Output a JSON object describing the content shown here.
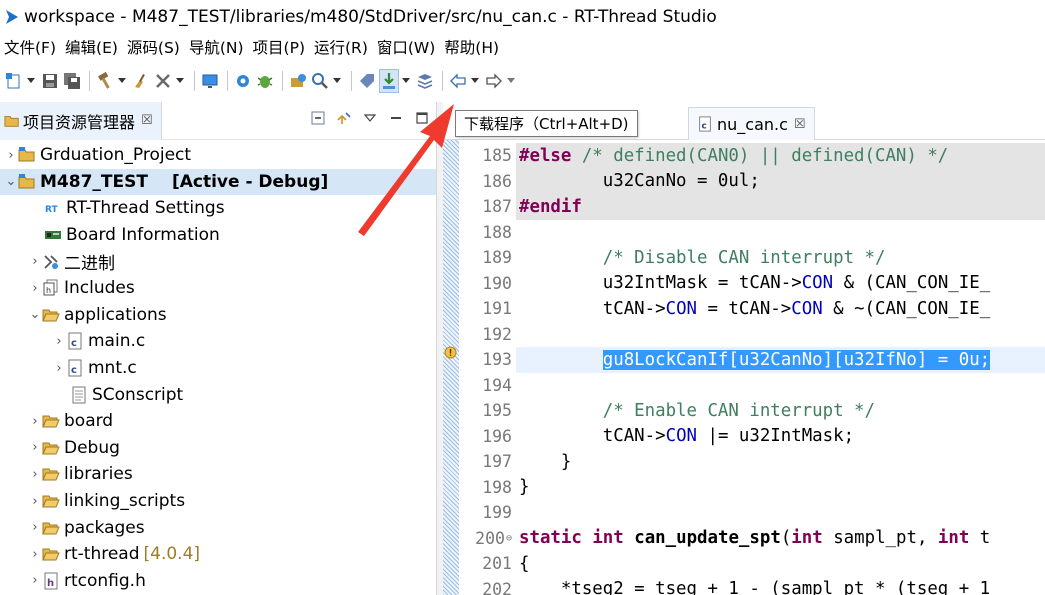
{
  "window": {
    "title": "workspace - M487_TEST/libraries/m480/StdDriver/src/nu_can.c - RT-Thread Studio"
  },
  "menubar": {
    "items": [
      "文件(F)",
      "编辑(E)",
      "源码(S)",
      "导航(N)",
      "项目(P)",
      "运行(R)",
      "窗口(W)",
      "帮助(H)"
    ]
  },
  "tooltip": {
    "text": "下载程序（Ctrl+Alt+D)"
  },
  "explorer": {
    "tab_label": "项目资源管理器",
    "close_glyph": "☒",
    "items": [
      {
        "label": "Grduation_Project"
      },
      {
        "label": "M487_TEST",
        "status": "[Active - Debug]"
      },
      {
        "label": "RT-Thread Settings"
      },
      {
        "label": "Board Information"
      },
      {
        "label": "二进制"
      },
      {
        "label": "Includes"
      },
      {
        "label": "applications"
      },
      {
        "label": "main.c"
      },
      {
        "label": "mnt.c"
      },
      {
        "label": "SConscript"
      },
      {
        "label": "board"
      },
      {
        "label": "Debug"
      },
      {
        "label": "libraries"
      },
      {
        "label": "linking_scripts"
      },
      {
        "label": "packages"
      },
      {
        "label": "rt-thread",
        "version": "[4.0.4]"
      },
      {
        "label": "rtconfig.h"
      }
    ]
  },
  "editor": {
    "tab_label": "nu_can.c",
    "close_glyph": "☒",
    "lines": [
      {
        "no": "185",
        "parts": [
          [
            "pp",
            "#else"
          ],
          [
            "cm",
            " /* defined(CAN0) || defined(CAN) */"
          ]
        ],
        "style": "greyed"
      },
      {
        "no": "186",
        "parts": [
          [
            "",
            "        u32CanNo = 0ul;"
          ]
        ],
        "style": "greyed"
      },
      {
        "no": "187",
        "parts": [
          [
            "pp",
            "#endif"
          ]
        ],
        "style": "greyed"
      },
      {
        "no": "188",
        "parts": [
          [
            "",
            ""
          ]
        ]
      },
      {
        "no": "189",
        "parts": [
          [
            "",
            "        "
          ],
          [
            "cm",
            "/* Disable CAN interrupt */"
          ]
        ]
      },
      {
        "no": "190",
        "parts": [
          [
            "",
            "        u32IntMask = tCAN->"
          ],
          [
            "fld",
            "CON"
          ],
          [
            "",
            " & (CAN_CON_IE_"
          ]
        ]
      },
      {
        "no": "191",
        "parts": [
          [
            "",
            "        tCAN->"
          ],
          [
            "fld",
            "CON"
          ],
          [
            "",
            " = tCAN->"
          ],
          [
            "fld",
            "CON"
          ],
          [
            "",
            " & ~(CAN_CON_IE_"
          ]
        ]
      },
      {
        "no": "192",
        "parts": [
          [
            "",
            ""
          ]
        ]
      },
      {
        "no": "193",
        "parts": [
          [
            "",
            "        "
          ],
          [
            "sel",
            "gu8LockCanIf[u32CanNo][u32IfNo] = 0u;"
          ]
        ],
        "style": "current"
      },
      {
        "no": "194",
        "parts": [
          [
            "",
            ""
          ]
        ]
      },
      {
        "no": "195",
        "parts": [
          [
            "",
            "        "
          ],
          [
            "cm",
            "/* Enable CAN interrupt */"
          ]
        ]
      },
      {
        "no": "196",
        "parts": [
          [
            "",
            "        tCAN->"
          ],
          [
            "fld",
            "CON"
          ],
          [
            "",
            " |= u32IntMask;"
          ]
        ]
      },
      {
        "no": "197",
        "parts": [
          [
            "",
            "    }"
          ]
        ]
      },
      {
        "no": "198",
        "parts": [
          [
            "",
            "}"
          ]
        ]
      },
      {
        "no": "199",
        "parts": [
          [
            "",
            ""
          ]
        ]
      },
      {
        "no": "200",
        "fold": "⊖",
        "parts": [
          [
            "kw",
            "static"
          ],
          [
            "",
            " "
          ],
          [
            "kw",
            "int"
          ],
          [
            "",
            " "
          ],
          [
            "fnbold",
            "can_update_spt"
          ],
          [
            "",
            "("
          ],
          [
            "kw",
            "int"
          ],
          [
            "",
            " sampl_pt, "
          ],
          [
            "kw",
            "int"
          ],
          [
            "",
            " t"
          ]
        ]
      },
      {
        "no": "201",
        "parts": [
          [
            "",
            "{"
          ]
        ]
      },
      {
        "no": "202",
        "parts": [
          [
            "",
            "    *tseg2 = tseg + 1 - (sampl_pt * (tseg + 1"
          ]
        ]
      }
    ]
  },
  "colors": {
    "keyword": "#7f0055",
    "comment": "#3f7f5f",
    "field": "#0000c0",
    "selection": "#3399ff",
    "arrow": "#ee3b2e"
  }
}
